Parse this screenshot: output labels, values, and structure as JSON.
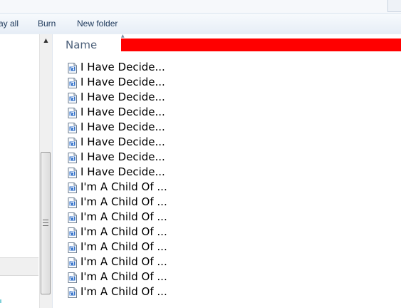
{
  "toolbar": {
    "play_all_label": "ay all",
    "burn_label": "Burn",
    "new_folder_label": "New folder"
  },
  "column_header": {
    "name_label": "Name"
  },
  "files": [
    {
      "name": "I Have Decide...",
      "icon": "audio-file-icon"
    },
    {
      "name": "I Have Decide...",
      "icon": "audio-file-icon"
    },
    {
      "name": "I Have Decide...",
      "icon": "audio-file-icon"
    },
    {
      "name": "I Have Decide...",
      "icon": "audio-file-icon"
    },
    {
      "name": "I Have Decide...",
      "icon": "audio-file-icon"
    },
    {
      "name": "I Have Decide...",
      "icon": "audio-file-icon"
    },
    {
      "name": "I Have Decide...",
      "icon": "audio-file-icon"
    },
    {
      "name": "I Have Decide...",
      "icon": "audio-file-icon"
    },
    {
      "name": "I'm A Child Of ...",
      "icon": "audio-file-icon"
    },
    {
      "name": "I'm A Child Of ...",
      "icon": "audio-file-icon"
    },
    {
      "name": "I'm A Child Of ...",
      "icon": "audio-file-icon"
    },
    {
      "name": "I'm A Child Of ...",
      "icon": "audio-file-icon"
    },
    {
      "name": "I'm A Child Of ...",
      "icon": "audio-file-icon"
    },
    {
      "name": "I'm A Child Of ...",
      "icon": "audio-file-icon"
    },
    {
      "name": "I'm A Child Of ...",
      "icon": "audio-file-icon"
    },
    {
      "name": "I'm A Child Of ...",
      "icon": "audio-file-icon"
    }
  ],
  "colors": {
    "toolbar_text": "#1e395b",
    "header_text": "#4c607a",
    "redaction": "#ff0000",
    "selection_fill": "#f0f0f0"
  }
}
